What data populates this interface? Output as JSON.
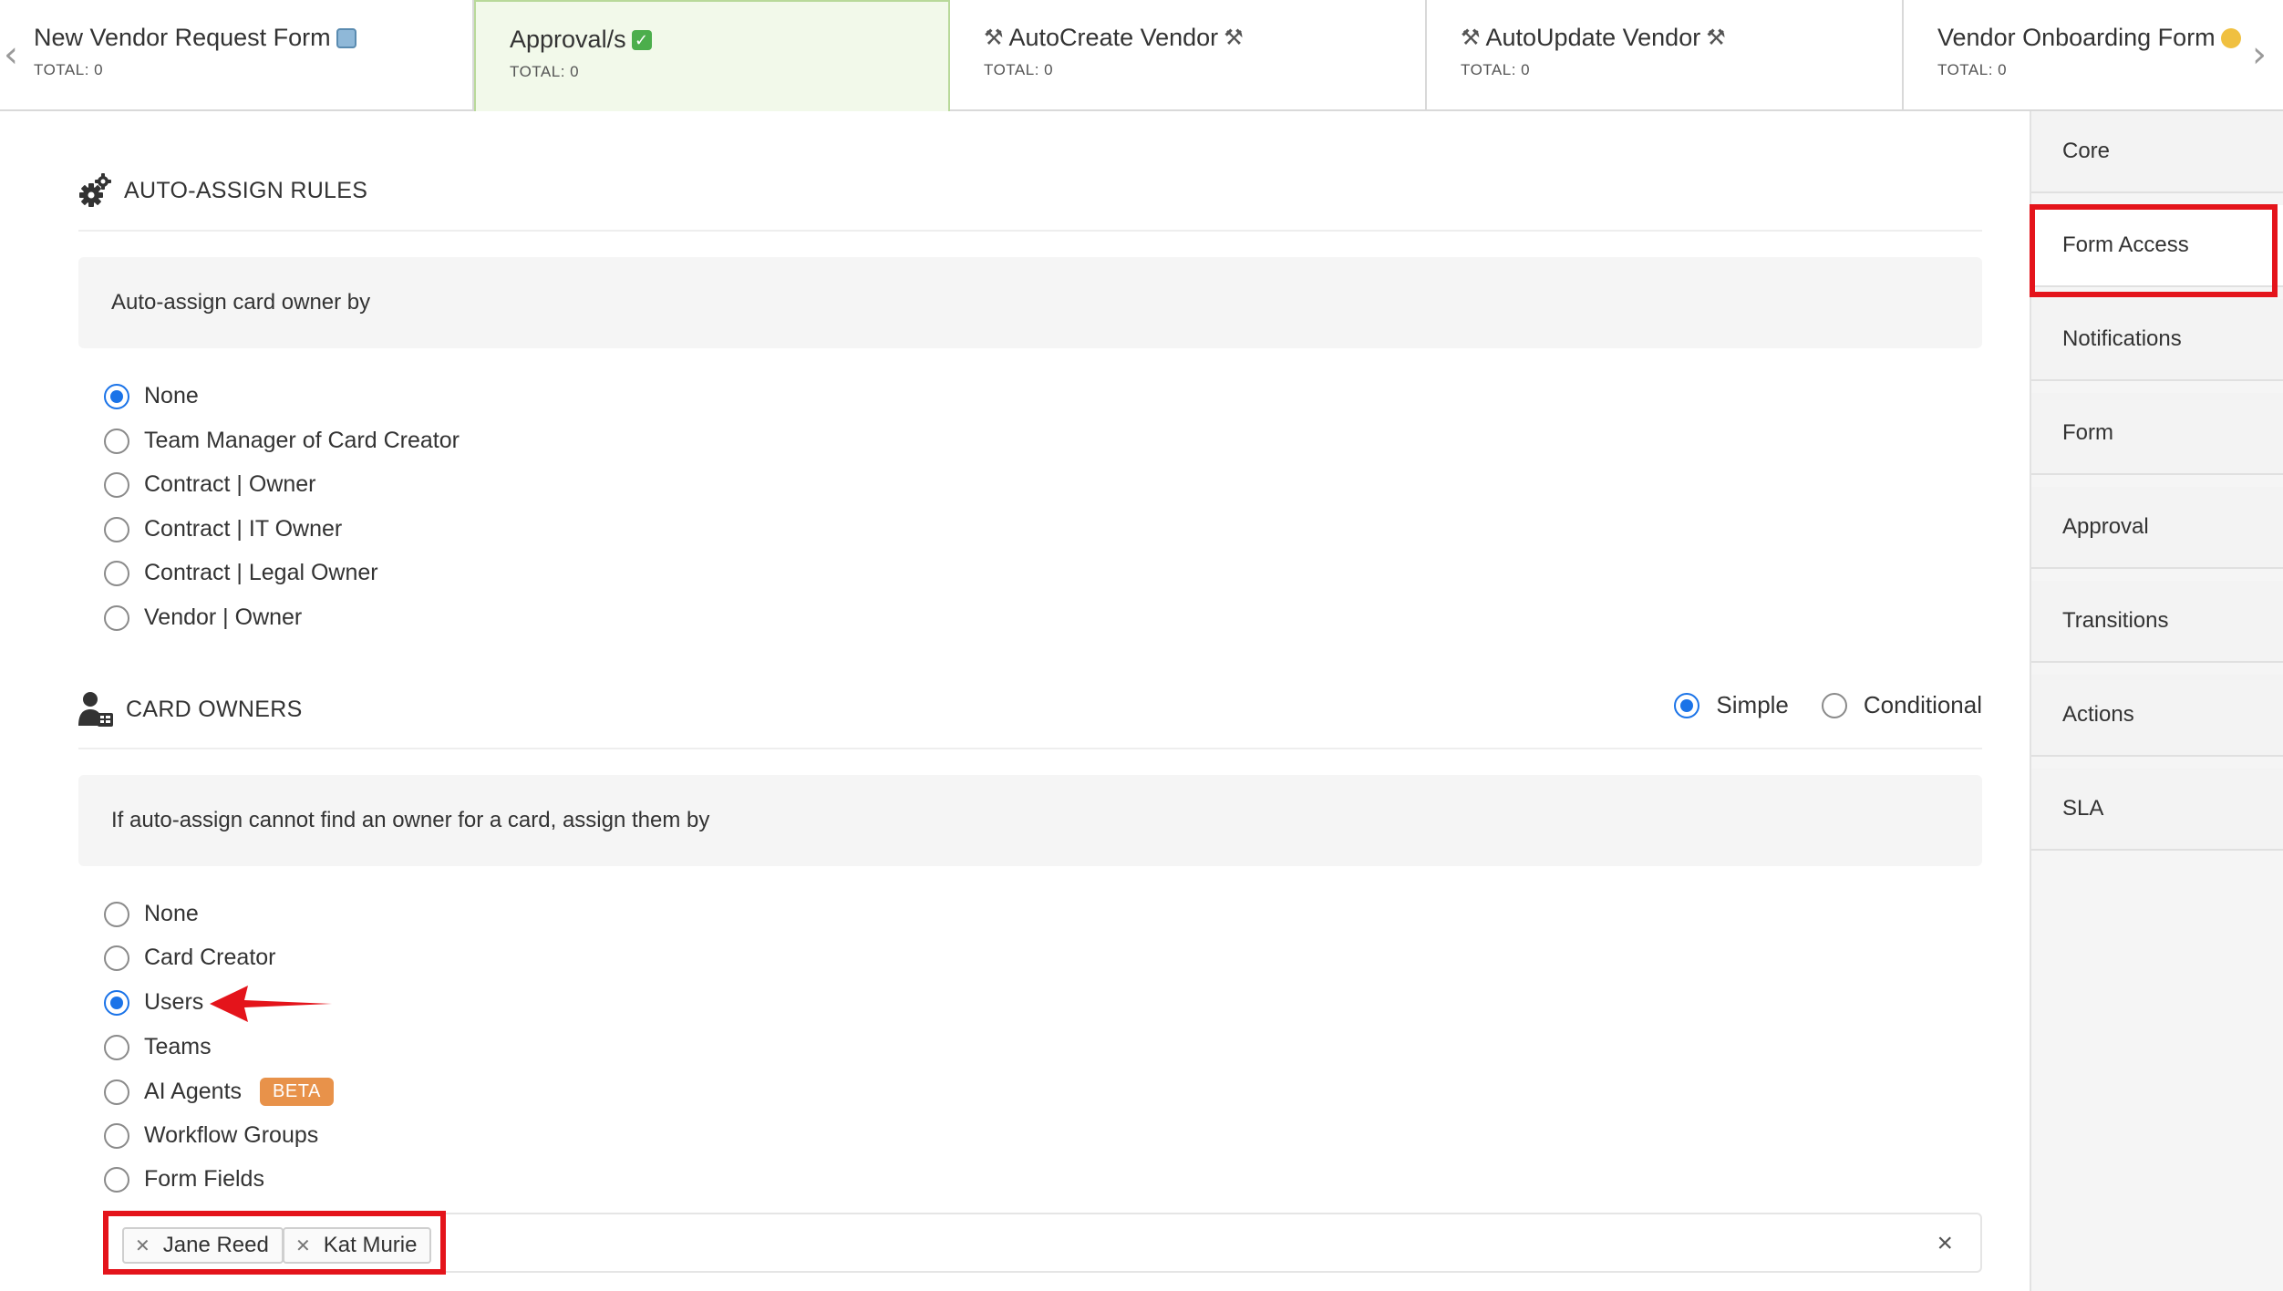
{
  "stages": [
    {
      "title": "New Vendor Request Form",
      "total": "TOTAL: 0",
      "emoji": "ballot-box-icon"
    },
    {
      "title": "Approval/s",
      "total": "TOTAL: 0",
      "emoji": "check-mark-icon",
      "active": true
    },
    {
      "title": "AutoCreate Vendor",
      "total": "TOTAL: 0",
      "emoji": "hammer-wrench-icon"
    },
    {
      "title": "AutoUpdate Vendor",
      "total": "TOTAL: 0",
      "emoji": "hammer-wrench-icon"
    },
    {
      "title": "Vendor Onboarding Form",
      "total": "TOTAL: 0",
      "emoji": "construction-worker-icon"
    }
  ],
  "auto_assign": {
    "heading": "AUTO-ASSIGN RULES",
    "info": "Auto-assign card owner by",
    "options": [
      "None",
      "Team Manager of Card Creator",
      "Contract | Owner",
      "Contract | IT Owner",
      "Contract | Legal Owner",
      "Vendor | Owner"
    ],
    "selected": "None"
  },
  "card_owners": {
    "heading": "CARD OWNERS",
    "mode_options": [
      "Simple",
      "Conditional"
    ],
    "mode_selected": "Simple",
    "info": "If auto-assign cannot find an owner for a card, assign them by",
    "options": [
      "None",
      "Card Creator",
      "Users",
      "Teams",
      "AI Agents",
      "Workflow Groups",
      "Form Fields"
    ],
    "selected": "Users",
    "badge": "BETA",
    "selected_users": [
      "Jane Reed",
      "Kat Murie"
    ]
  },
  "sidebar": {
    "items": [
      "Core",
      "Form Access",
      "Notifications",
      "Form",
      "Approval",
      "Transitions",
      "Actions",
      "SLA"
    ],
    "highlighted": "Form Access"
  },
  "colors": {
    "accent": "#1a73e8",
    "highlight": "#e4141b",
    "active_stage_bg": "#f2f9ea",
    "beta_badge": "#e8924a"
  }
}
